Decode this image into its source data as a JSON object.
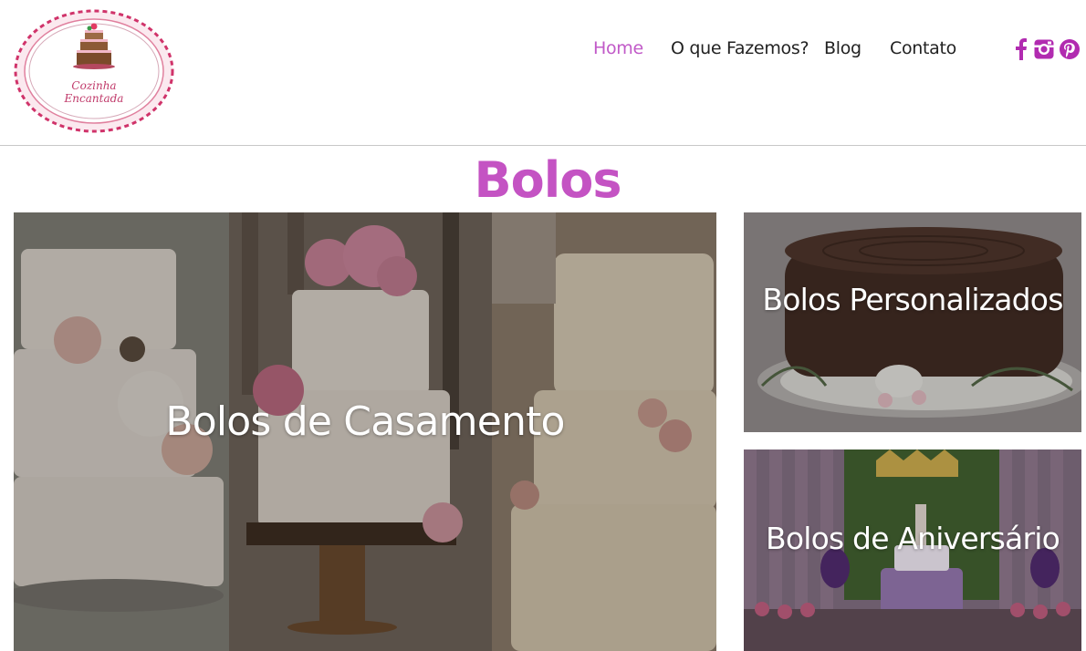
{
  "brand": {
    "logo_line1": "Cozinha",
    "logo_line2": "Encantada"
  },
  "nav": {
    "items": [
      {
        "label": "Home",
        "active": true
      },
      {
        "label": "O que Fazemos?",
        "active": false
      },
      {
        "label": "Blog",
        "active": false
      },
      {
        "label": "Contato",
        "active": false
      }
    ],
    "active_color": "#c15ac8"
  },
  "social": [
    {
      "icon": "facebook-icon"
    },
    {
      "icon": "instagram-icon"
    },
    {
      "icon": "pinterest-icon"
    }
  ],
  "section": {
    "title": "Bolos",
    "title_color": "#c453c3"
  },
  "tiles": {
    "casamento": {
      "label": "Bolos de Casamento"
    },
    "personalizados": {
      "label": "Bolos Personalizados"
    },
    "aniversario": {
      "label": "Bolos de Aniversário"
    }
  },
  "colors": {
    "accent": "#c15ac8",
    "logo_red": "#c03a6a",
    "header_rule": "#c8c8c8"
  }
}
